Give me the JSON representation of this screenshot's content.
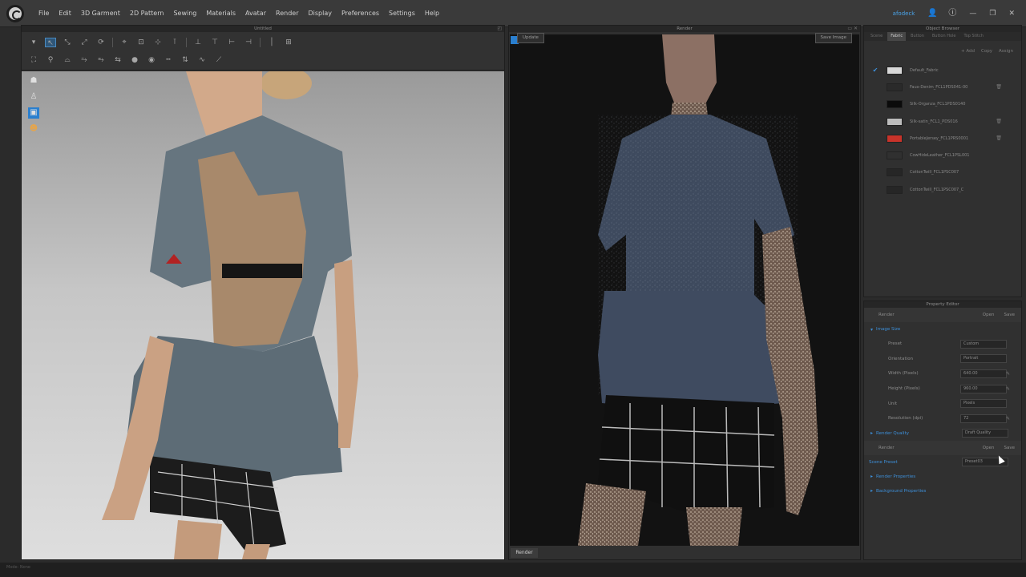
{
  "menu": [
    "File",
    "Edit",
    "3D Garment",
    "2D Pattern",
    "Sewing",
    "Materials",
    "Avatar",
    "Render",
    "Display",
    "Preferences",
    "Settings",
    "Help"
  ],
  "user": {
    "name": "afodeck"
  },
  "view3d": {
    "title": "Untitled"
  },
  "render": {
    "title": "Render",
    "btn_update": "Update",
    "btn_save": "Save Image",
    "tab": "Render"
  },
  "object_browser": {
    "title": "Object Browser",
    "tabs": [
      "Scene",
      "Fabric",
      "Button",
      "Button Hole",
      "Top Stitch"
    ],
    "active_tab": "Fabric",
    "actions": [
      "+ Add",
      "Copy",
      "Assign"
    ],
    "fabrics": [
      {
        "name": "Default_Fabric",
        "color": "#d8d8d8",
        "checked": true
      },
      {
        "name": "Faux-Denim_FCL1PDS041-00",
        "color": "#2a2a2a",
        "checked": false
      },
      {
        "name": "Silk-Organza_FCL1PDS0140",
        "color": "#0b0b0b",
        "checked": false
      },
      {
        "name": "Silk-satin_FCL1_PDS016",
        "color": "#bdbdbd",
        "checked": false
      },
      {
        "name": "PortableJersey_FCL1PRS0001",
        "color": "#c8332a",
        "checked": false
      },
      {
        "name": "CowHideLeather_FCL1PSL001",
        "color": "#303030",
        "checked": false
      },
      {
        "name": "CottonTwill_FCL1PSC007",
        "color": "#262626",
        "checked": false
      },
      {
        "name": "CottonTwill_FCL1PSC007_C",
        "color": "#262626",
        "checked": false
      }
    ]
  },
  "property_editor": {
    "title": "Property Editor",
    "render_label": "Render",
    "open_label": "Open",
    "save_label": "Save",
    "image_size": "Image Size",
    "rows": [
      {
        "label": "Preset",
        "value": "Custom"
      },
      {
        "label": "Orientation",
        "value": "Portrait"
      },
      {
        "label": "Width (Pixels)",
        "value": "640.00"
      },
      {
        "label": "Height (Pixels)",
        "value": "960.00"
      },
      {
        "label": "Unit",
        "value": "Pixels"
      },
      {
        "label": "Resolution (dpi)",
        "value": "72"
      }
    ],
    "render_quality": "Render Quality",
    "render_quality_value": "Draft Quality",
    "scene_preset": "Scene Preset",
    "scene_preset_value": "Preset03",
    "render_properties": "Render Properties",
    "background_properties": "Background Properties"
  },
  "status": {
    "text": "Mode: None"
  }
}
